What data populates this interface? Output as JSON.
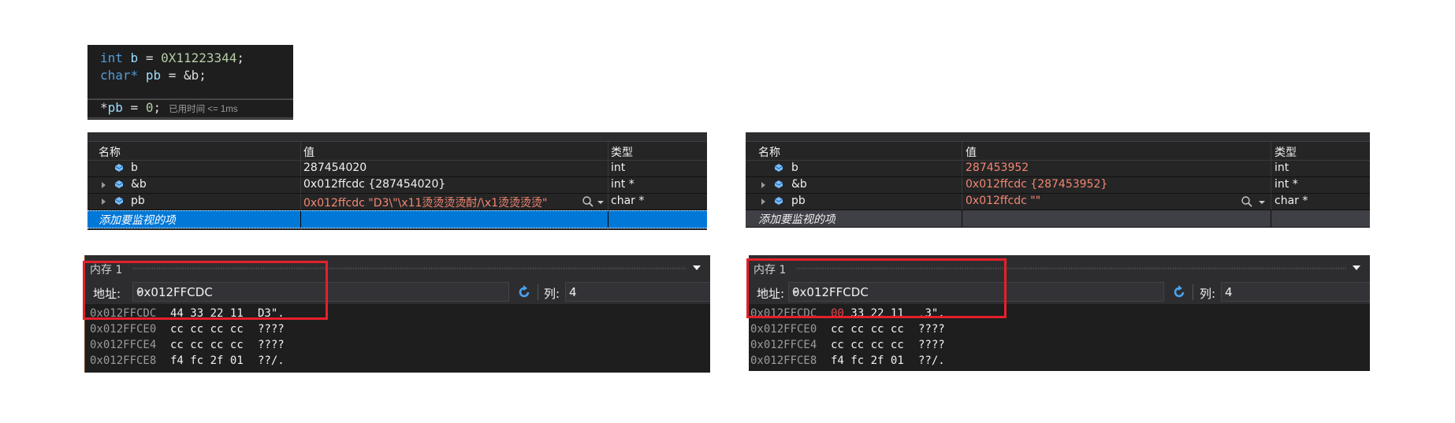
{
  "code": {
    "lines": [
      {
        "kw": "int",
        "var": "b",
        "op": " = ",
        "num": "0X11223344",
        "end": ";"
      },
      {
        "kw": "char*",
        "var": "pb",
        "op": " = ",
        "rest": "&b;"
      },
      {
        "pre": "*",
        "var": "pb",
        "op": " = ",
        "num": "0",
        "end": ";",
        "elapsed": "已用时间 <= 1ms"
      }
    ]
  },
  "watch_before": {
    "headers": {
      "name": "名称",
      "value": "值",
      "type": "类型"
    },
    "rows": [
      {
        "name": "b",
        "value": "287454020",
        "type": "int",
        "expandable": false,
        "changed": false
      },
      {
        "name": "&b",
        "value": "0x012ffcdc {287454020}",
        "type": "int *",
        "expandable": true,
        "changed": false
      },
      {
        "name": "pb",
        "value": "0x012ffcdc \"D3\\\"\\x11烫烫烫烫酎/\\x1烫烫烫烫\"",
        "type": "char *",
        "expandable": true,
        "changed": true
      }
    ],
    "add_item_label": "添加要监视的项"
  },
  "watch_after": {
    "headers": {
      "name": "名称",
      "value": "值",
      "type": "类型"
    },
    "rows": [
      {
        "name": "b",
        "value": "287453952",
        "type": "int",
        "expandable": false,
        "changed": true
      },
      {
        "name": "&b",
        "value": "0x012ffcdc {287453952}",
        "type": "int *",
        "expandable": true,
        "changed": true
      },
      {
        "name": "pb",
        "value": "0x012ffcdc \"\"",
        "type": "char *",
        "expandable": true,
        "changed": true
      }
    ],
    "add_item_label": "添加要监视的项"
  },
  "memory_before": {
    "title": "内存 1",
    "address_label": "地址:",
    "address_value": "0x012FFCDC",
    "columns_label": "列:",
    "columns_value": "4",
    "rows": [
      {
        "addr": "0x012FFCDC",
        "bytes": [
          "44",
          "33",
          "22",
          "11"
        ],
        "chars": "D3\"."
      },
      {
        "addr": "0x012FFCE0",
        "bytes": [
          "cc",
          "cc",
          "cc",
          "cc"
        ],
        "chars": "????"
      },
      {
        "addr": "0x012FFCE4",
        "bytes": [
          "cc",
          "cc",
          "cc",
          "cc"
        ],
        "chars": "????"
      },
      {
        "addr": "0x012FFCE8",
        "bytes": [
          "f4",
          "fc",
          "2f",
          "01"
        ],
        "chars": "??/."
      }
    ]
  },
  "memory_after": {
    "title": "内存 1",
    "address_label": "地址:",
    "address_value": "0x012FFCDC",
    "columns_label": "列:",
    "columns_value": "4",
    "rows": [
      {
        "addr": "0x012FFCDC",
        "bytes": [
          "00",
          "33",
          "22",
          "11"
        ],
        "chars": ".3\".",
        "changed_byte": "00",
        "changed_char": "."
      },
      {
        "addr": "0x012FFCE0",
        "bytes": [
          "cc",
          "cc",
          "cc",
          "cc"
        ],
        "chars": "????"
      },
      {
        "addr": "0x012FFCE4",
        "bytes": [
          "cc",
          "cc",
          "cc",
          "cc"
        ],
        "chars": "????"
      },
      {
        "addr": "0x012FFCE8",
        "bytes": [
          "f4",
          "fc",
          "2f",
          "01"
        ],
        "chars": "??/."
      }
    ]
  },
  "colors": {
    "changed_value": "#f48771",
    "changed_byte": "#e0474c",
    "highlight_box": "#e5202a",
    "selection": "#0078d7"
  }
}
